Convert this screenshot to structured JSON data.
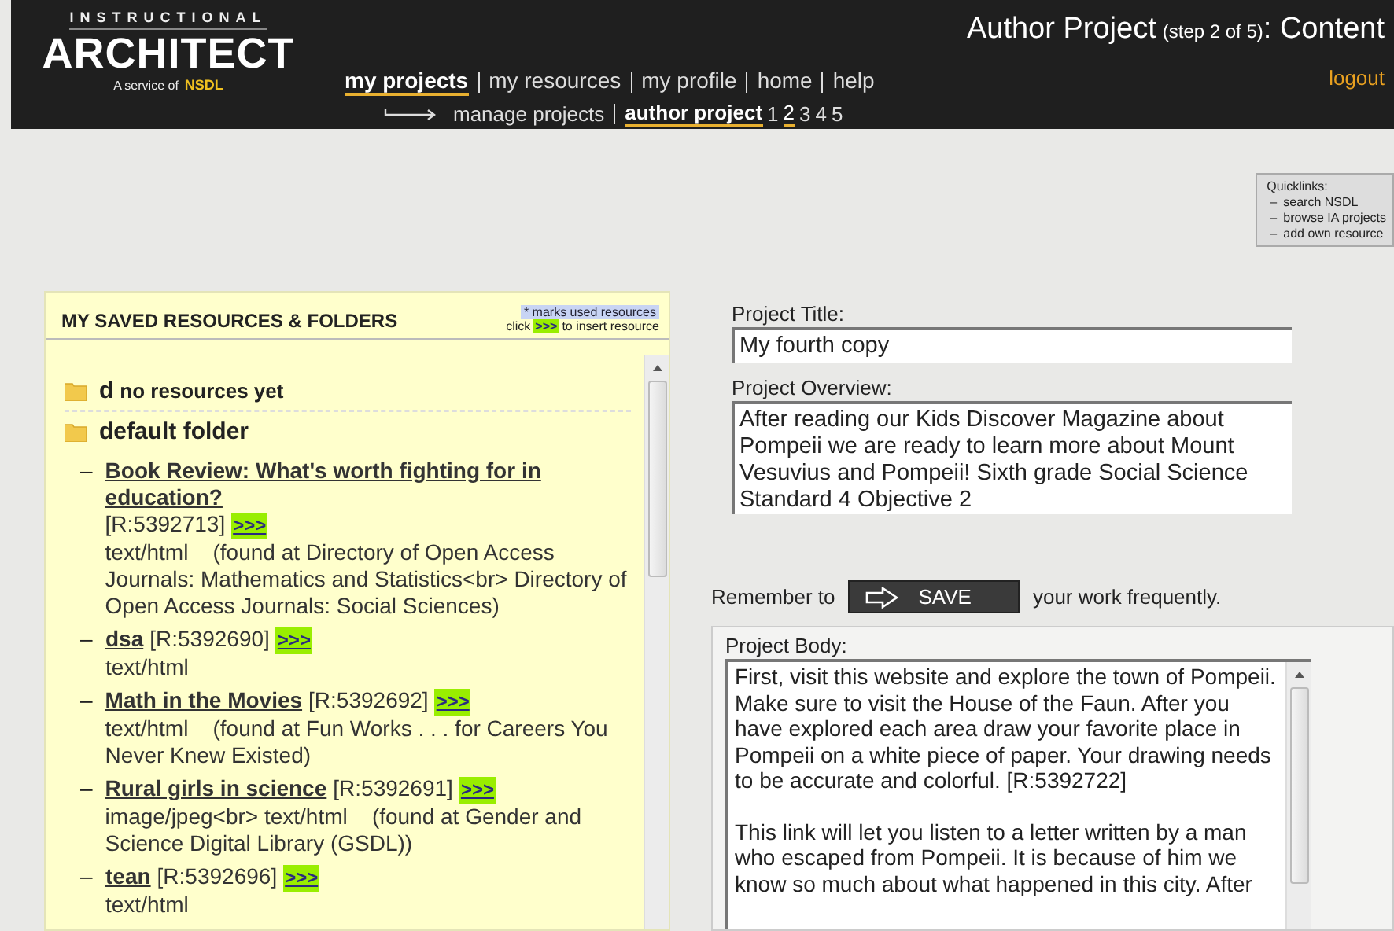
{
  "logo": {
    "top": "INSTRUCTIONAL",
    "name": "ARCHITECT",
    "service": "A service of",
    "partner": "NSDL"
  },
  "nav": [
    {
      "label": "my projects",
      "selected": true
    },
    {
      "label": "my resources",
      "selected": false
    },
    {
      "label": "my profile",
      "selected": false
    },
    {
      "label": "home",
      "selected": false
    },
    {
      "label": "help",
      "selected": false
    }
  ],
  "subnav": {
    "links": [
      {
        "label": "manage projects",
        "selected": false
      },
      {
        "label": "author project",
        "selected": true
      }
    ],
    "steps": [
      {
        "label": "1",
        "selected": false
      },
      {
        "label": "2",
        "selected": true
      },
      {
        "label": "3",
        "selected": false
      },
      {
        "label": "4",
        "selected": false
      },
      {
        "label": "5",
        "selected": false
      }
    ]
  },
  "page_title": {
    "main": "Author Project",
    "step": "(step 2 of 5)",
    "section": ": Content"
  },
  "logout": "logout",
  "quicklinks": {
    "title": "Quicklinks:",
    "items": [
      {
        "marker": "–",
        "label": "search NSDL"
      },
      {
        "marker": "–",
        "label": "browse IA projects"
      },
      {
        "marker": "–",
        "label": "add own resource"
      }
    ]
  },
  "resources_panel": {
    "title": "MY SAVED RESOURCES & FOLDERS",
    "legend": "* marks used resources",
    "hint_before": "click",
    "hint_button": ">>>",
    "hint_after": "to insert resource",
    "folders": [
      {
        "name": "d",
        "note": "no resources yet"
      },
      {
        "name": "default folder",
        "resources": [
          {
            "marker": "–",
            "title": "Book Review: What's worth fighting for in education?",
            "id": "[R:5392713]",
            "insert": ">>>",
            "details": "text/html    (found at Directory of Open Access Journals: Mathematics and Statistics<br> Directory of Open Access Journals: Social Sciences)"
          },
          {
            "marker": "–",
            "title": "dsa",
            "id": "[R:5392690]",
            "insert": ">>>",
            "details": "text/html"
          },
          {
            "marker": "–",
            "title": "Math in the Movies",
            "id": "[R:5392692]",
            "insert": ">>>",
            "details": "text/html    (found at Fun Works . . . for Careers You Never Knew Existed)"
          },
          {
            "marker": "–",
            "title": "Rural girls in science",
            "id": "[R:5392691]",
            "insert": ">>>",
            "details": "image/jpeg<br> text/html    (found at Gender and Science Digital Library (GSDL))"
          },
          {
            "marker": "–",
            "title": "tean",
            "id": "[R:5392696]",
            "insert": ">>>",
            "details": "text/html"
          }
        ]
      }
    ]
  },
  "project_title": {
    "label": "Project Title:",
    "value": "My fourth copy"
  },
  "project_overview": {
    "label": "Project Overview:",
    "value": "After reading our Kids Discover Magazine about Pompeii we are ready to learn more about Mount Vesuvius and Pompeii!  Sixth grade Social Science Standard 4 Objective 2"
  },
  "save_reminder": {
    "before": "Remember to",
    "button": "SAVE",
    "after": "your work frequently."
  },
  "project_body": {
    "label": "Project Body:",
    "paragraphs": [
      "First, visit this website and explore the town of Pompeii. Make sure to visit the House of the Faun. After you have explored each area draw your favorite place in Pompeii on a white piece of paper. Your drawing needs to be accurate and colorful. [R:5392722]",
      "This link will let you listen to a letter written by a man who escaped from Pompeii.  It is because of him we know so much about what happened in this city.  After"
    ]
  }
}
